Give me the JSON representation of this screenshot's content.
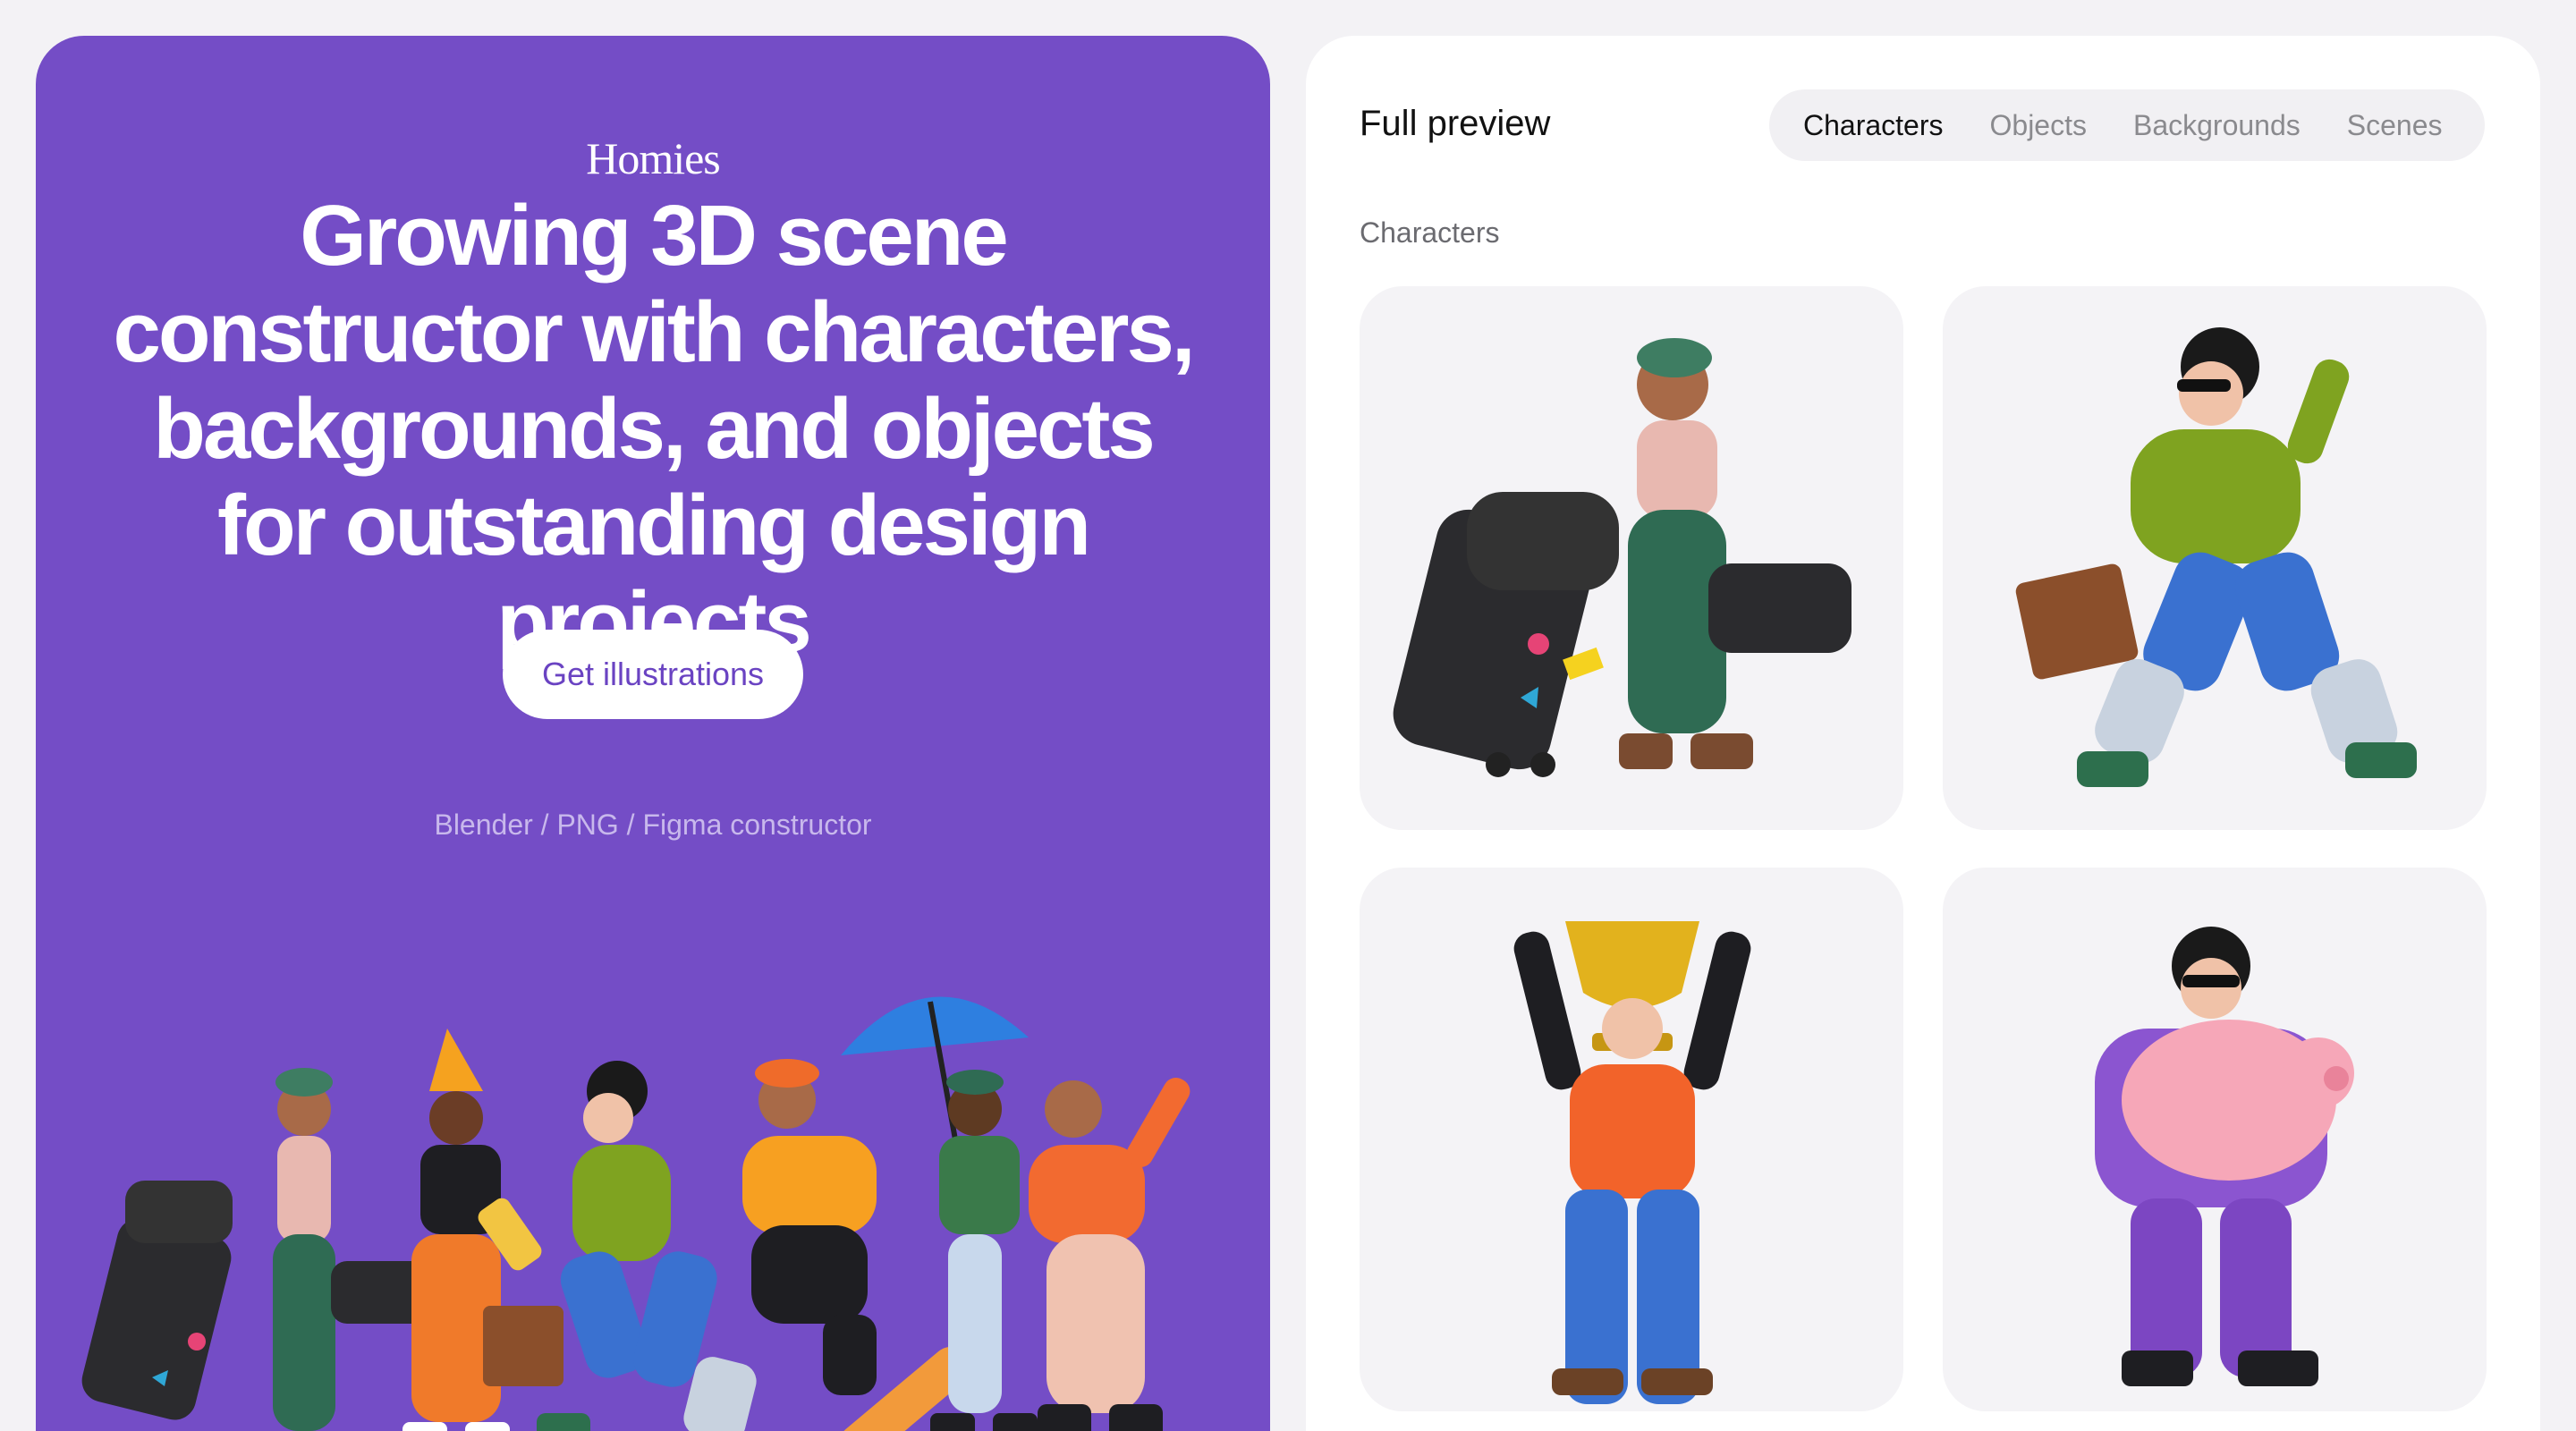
{
  "hero": {
    "brand": "Homies",
    "headline": "Growing 3D scene constructor with characters, backgrounds, and objects for outstanding design projects",
    "cta_label": "Get illustrations",
    "formats": "Blender / PNG / Figma constructor",
    "background_color": "#744dc6"
  },
  "preview": {
    "title": "Full preview",
    "tabs": [
      {
        "label": "Characters",
        "active": true
      },
      {
        "label": "Objects",
        "active": false
      },
      {
        "label": "Backgrounds",
        "active": false
      },
      {
        "label": "Scenes",
        "active": false
      }
    ],
    "section_label": "Characters",
    "cards": [
      {
        "icon": "traveler-with-luggage-illustration"
      },
      {
        "icon": "walking-woman-with-briefcase-illustration"
      },
      {
        "icon": "man-holding-trophy-illustration"
      },
      {
        "icon": "woman-holding-piggy-bank-illustration"
      }
    ]
  }
}
